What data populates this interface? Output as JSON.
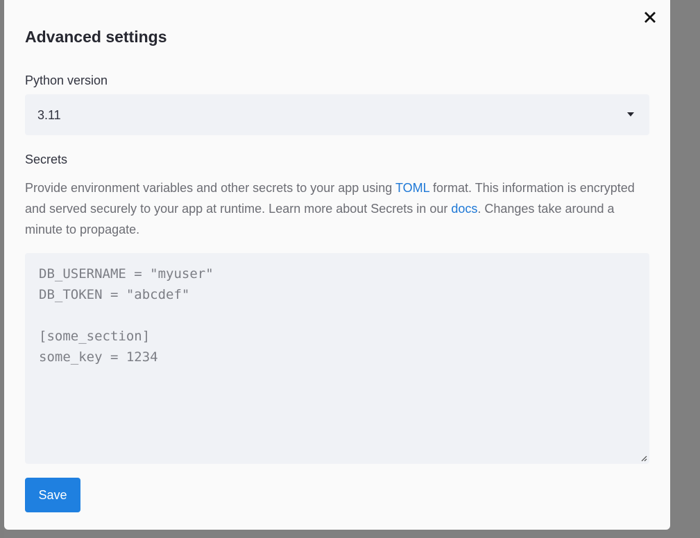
{
  "dialog": {
    "title": "Advanced settings",
    "close_icon": "close-icon"
  },
  "python": {
    "label": "Python version",
    "selected": "3.11",
    "caret_icon": "caret-down-icon"
  },
  "secrets": {
    "label": "Secrets",
    "desc_part1": "Provide environment variables and other secrets to your app using ",
    "toml_link": "TOML",
    "desc_part2": " format. This information is encrypted and served securely to your app at runtime. Learn more about Secrets in our ",
    "docs_link": "docs",
    "desc_part3": ". Changes take around a minute to propagate.",
    "placeholder_lines": [
      "DB_USERNAME = \"myuser\"",
      "DB_TOKEN = \"abcdef\"",
      "",
      "[some_section]",
      "some_key = 1234"
    ]
  },
  "actions": {
    "save_label": "Save"
  },
  "colors": {
    "primary": "#1f80e0",
    "link": "#1e78d6",
    "field_bg": "#f0f2f6",
    "dialog_bg": "#fafafa",
    "backdrop": "#808080"
  }
}
